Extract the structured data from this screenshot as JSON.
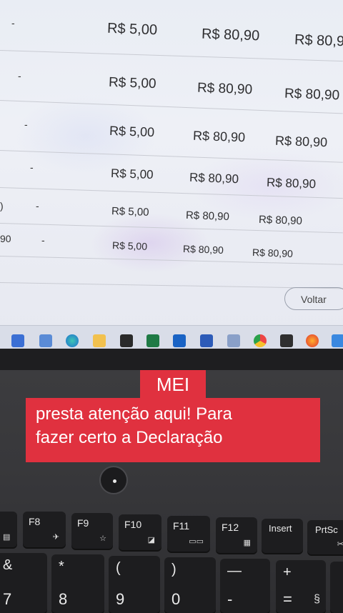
{
  "screen": {
    "rows": [
      {
        "dash": "-",
        "value1": "R$ 5,00",
        "value2": "R$ 80,90",
        "value3": "R$ 80,9",
        "lead": ""
      },
      {
        "dash": "-",
        "value1": "R$ 5,00",
        "value2": "R$ 80,90",
        "value3": "R$ 80,90",
        "lead": ""
      },
      {
        "dash": "-",
        "value1": "R$ 5,00",
        "value2": "R$ 80,90",
        "value3": "R$ 80,90",
        "lead": ""
      },
      {
        "dash": "-",
        "value1": "R$ 5,00",
        "value2": "R$ 80,90",
        "value3": "R$ 80,90",
        "lead": ""
      },
      {
        "dash": "-",
        "value1": "R$ 5,00",
        "value2": "R$ 80,90",
        "value3": "R$ 80,90",
        "lead": ")"
      },
      {
        "dash": "-",
        "value1": "R$ 5,00",
        "value2": "R$ 80,90",
        "value3": "R$ 80,90",
        "lead": "90"
      }
    ],
    "top_dash": "-",
    "back_button": "Voltar"
  },
  "taskbar_icons": [
    "calendar-icon",
    "store-icon",
    "edge-icon",
    "explorer-icon",
    "sticky-icon",
    "excel-icon",
    "outlook-icon",
    "word-icon",
    "snip-icon",
    "chrome-icon",
    "terminal-icon",
    "firefox-icon",
    "photos-icon"
  ],
  "caption": {
    "line1": "MEI",
    "line2": "presta atenção aqui! Para",
    "line3": "fazer certo a Declaração",
    "color": "#e0313f"
  },
  "keyboard": {
    "fkeys": [
      {
        "label": "",
        "icon": "▤"
      },
      {
        "label": "F8",
        "icon": "✈"
      },
      {
        "label": "F9",
        "icon": "☆"
      },
      {
        "label": "F10",
        "icon": "◪"
      },
      {
        "label": "F11",
        "icon": "▭▭"
      },
      {
        "label": "F12",
        "icon": "▦"
      },
      {
        "label": "Insert",
        "icon": ""
      },
      {
        "label": "PrtSc",
        "icon": "✂"
      }
    ],
    "numkeys": [
      {
        "top": "&",
        "bottom": "7"
      },
      {
        "top": "*",
        "bottom": "8"
      },
      {
        "top": "(",
        "bottom": "9"
      },
      {
        "top": ")",
        "bottom": "0"
      },
      {
        "top": "—",
        "bottom": "-"
      },
      {
        "top": "+",
        "bottom": "="
      }
    ],
    "extra_symbol": "§"
  }
}
